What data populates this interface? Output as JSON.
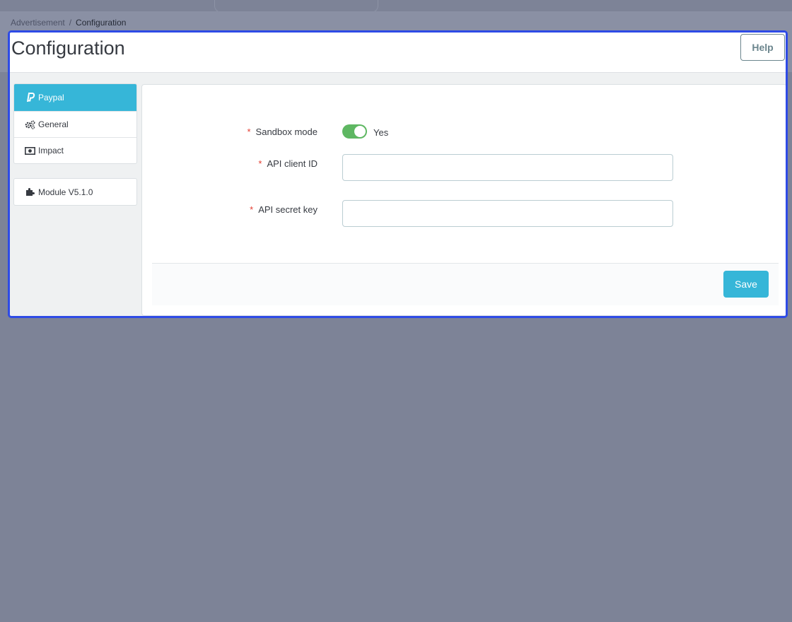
{
  "breadcrumb": {
    "parent": "Advertisement",
    "separator": "/",
    "current": "Configuration"
  },
  "header": {
    "title": "Configuration",
    "help_label": "Help"
  },
  "sidebar": {
    "items": [
      {
        "label": "Paypal",
        "icon": "paypal-icon",
        "active": true
      },
      {
        "label": "General",
        "icon": "cogs-icon",
        "active": false
      },
      {
        "label": "Impact",
        "icon": "money-icon",
        "active": false
      }
    ],
    "version": {
      "label": "Module V5.1.0",
      "icon": "puzzle-icon"
    }
  },
  "form": {
    "required_mark": "*",
    "sandbox": {
      "label": "Sandbox mode",
      "value": "Yes",
      "enabled": true
    },
    "client_id": {
      "label": "API client ID",
      "value": ""
    },
    "secret_key": {
      "label": "API secret key",
      "value": ""
    },
    "save_label": "Save"
  },
  "colors": {
    "accent": "#36b6d8",
    "toggle_on": "#5eb762",
    "required": "#e43d31",
    "frame_highlight": "#2e4be6"
  }
}
